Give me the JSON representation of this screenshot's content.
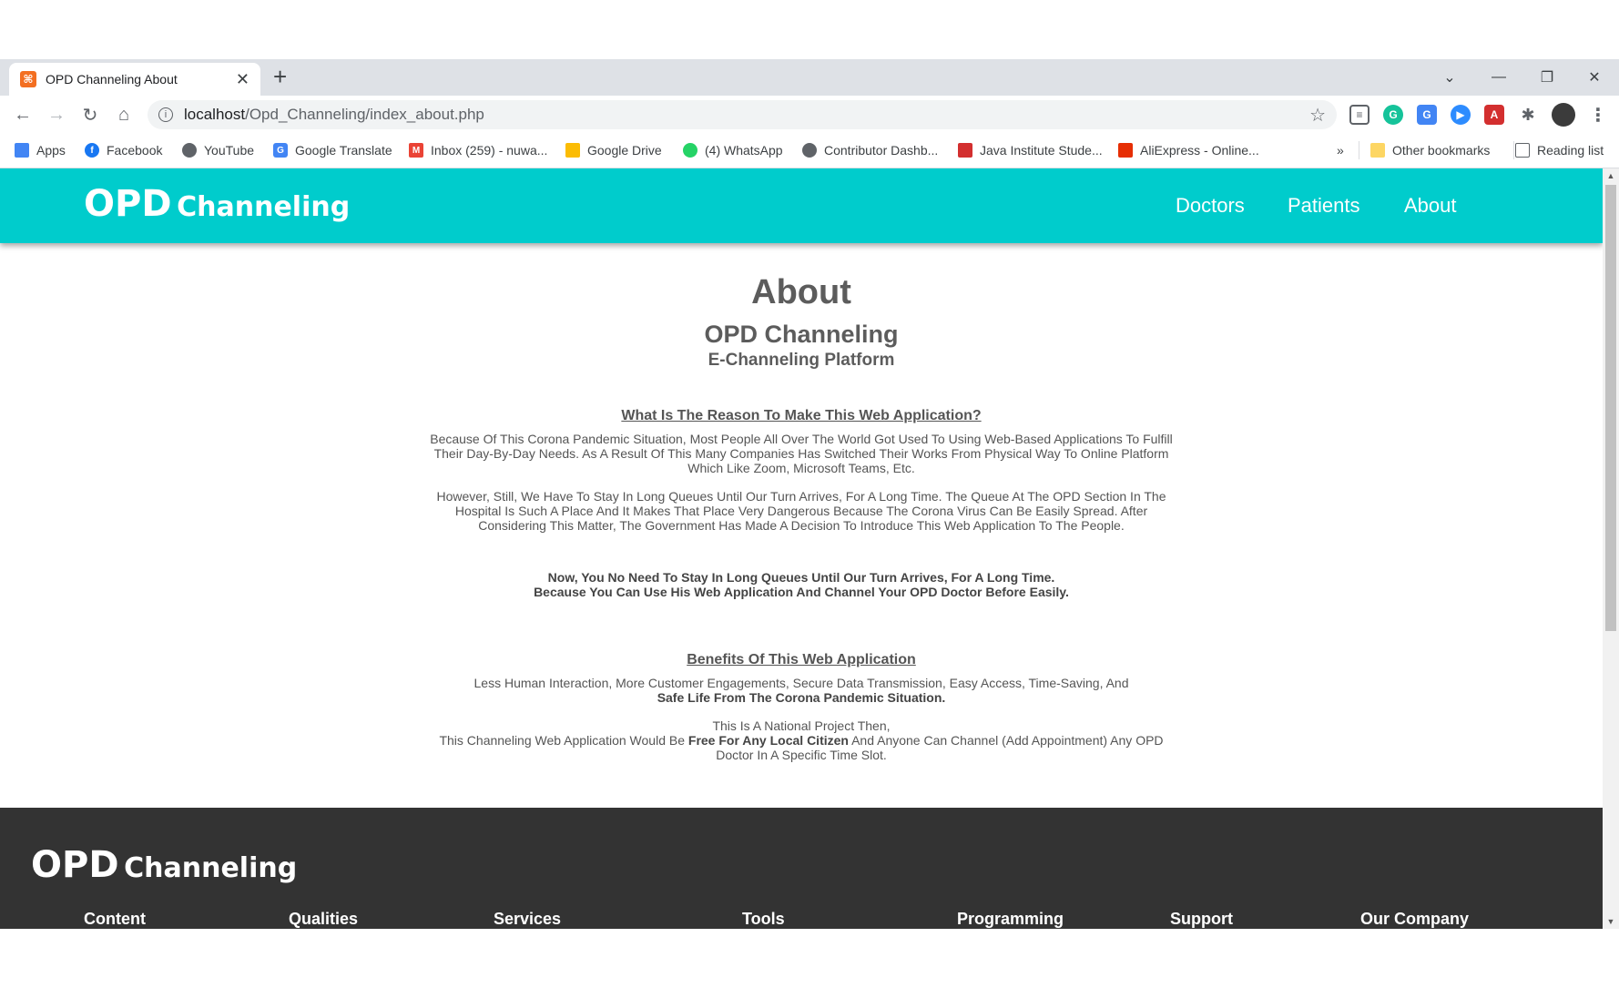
{
  "browser": {
    "tab_title": "OPD Channeling About",
    "favicon_glyph": "⌘",
    "url_host": "localhost",
    "url_path": "/Opd_Channeling/index_about.php",
    "bookmarks": [
      {
        "label": "Apps",
        "icon": "apps-grid-icon",
        "color": "#4285f4"
      },
      {
        "label": "Facebook",
        "icon": "facebook-icon",
        "color": "#1877f2"
      },
      {
        "label": "YouTube",
        "icon": "globe-icon",
        "color": "#5f6368"
      },
      {
        "label": "Google Translate",
        "icon": "google-translate-icon",
        "color": "#4285f4"
      },
      {
        "label": "Inbox (259) - nuwa...",
        "icon": "gmail-icon",
        "color": "#ea4335"
      },
      {
        "label": "Google Drive",
        "icon": "google-drive-icon",
        "color": "#fbbc04"
      },
      {
        "label": "(4) WhatsApp",
        "icon": "whatsapp-icon",
        "color": "#25d366"
      },
      {
        "label": "Contributor Dashb...",
        "icon": "globe-icon",
        "color": "#5f6368"
      },
      {
        "label": "Java Institute Stude...",
        "icon": "java-institute-icon",
        "color": "#d32f2f"
      },
      {
        "label": "AliExpress - Online...",
        "icon": "aliexpress-icon",
        "color": "#e62e04"
      }
    ],
    "more_bookmarks": "»",
    "other_bookmarks": "Other bookmarks",
    "reading_list": "Reading list"
  },
  "site": {
    "brand_part1": "OPD",
    "brand_part2": "Channeling",
    "nav": [
      "Doctors",
      "Patients",
      "About"
    ]
  },
  "about": {
    "title": "About",
    "subtitle": "OPD Channeling",
    "tagline": "E-Channeling Platform",
    "reason_heading": "What Is The Reason To Make This Web Application?",
    "reason_p1": "Because Of This Corona Pandemic Situation, Most People All Over The World Got Used To Using Web-Based Applications To Fulfill Their Day-By-Day Needs. As A Result Of This Many Companies Has Switched Their Works From Physical Way To Online Platform Which Like Zoom, Microsoft Teams, Etc.",
    "reason_p2": "However, Still, We Have To Stay In Long Queues Until Our Turn Arrives, For A Long Time. The Queue At The OPD Section In The Hospital Is Such A Place And It Makes That Place Very Dangerous Because The Corona Virus Can Be Easily Spread. After Considering This Matter, The Government Has Made A Decision To Introduce This Web Application To The People.",
    "highlight_line1": "Now, You No Need To Stay In Long Queues Until Our Turn Arrives, For A Long Time.",
    "highlight_line2": "Because You Can Use His Web Application And Channel Your OPD Doctor Before Easily.",
    "benefits_heading": "Benefits Of This Web Application",
    "benefits_line1": "Less Human Interaction, More Customer Engagements, Secure Data Transmission, Easy Access, Time-Saving, And",
    "benefits_line2_bold": "Safe Life From The Corona Pandemic Situation.",
    "national_line1": "This Is A National Project Then,",
    "national_pre": "This Channeling Web Application Would Be ",
    "national_bold": "Free For Any Local Citizen",
    "national_post": " And Anyone Can Channel (Add Appointment) Any OPD Doctor In A Specific Time Slot."
  },
  "footer": {
    "brand_part1": "OPD",
    "brand_part2": "Channeling",
    "columns": [
      "Content",
      "Qualities",
      "Services",
      "Tools",
      "Programming",
      "Support",
      "Our Company"
    ]
  },
  "colors": {
    "navbar": "#00cccc",
    "footer": "#333333",
    "text": "#555555"
  }
}
